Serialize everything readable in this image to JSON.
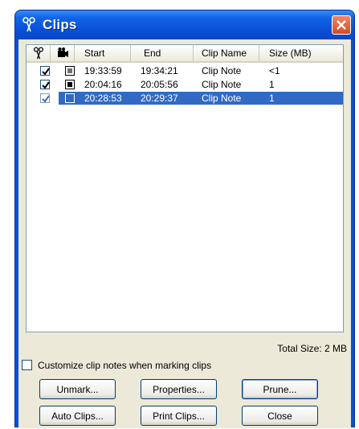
{
  "window": {
    "title": "Clips",
    "accent": "#0a4fd8",
    "icon": "scissors-icon"
  },
  "list": {
    "columns": {
      "mark_icon": "scissors-icon",
      "clip_icon": "camera-icon",
      "start": "Start",
      "end": "End",
      "clip_name": "Clip Name",
      "size": "Size (MB)"
    },
    "rows": [
      {
        "checked": true,
        "clip_state": "grey",
        "start": "19:33:59",
        "end": "19:34:21",
        "name": "Clip Note",
        "size": "<1",
        "selected": false
      },
      {
        "checked": true,
        "clip_state": "black",
        "start": "20:04:16",
        "end": "20:05:56",
        "name": "Clip Note",
        "size": "1",
        "selected": false
      },
      {
        "checked": true,
        "clip_state": "empty",
        "start": "20:28:53",
        "end": "20:29:37",
        "name": "Clip Note",
        "size": "1",
        "selected": true
      }
    ],
    "selection_color": "#316ac5"
  },
  "total_size": "Total Size: 2 MB",
  "customize_option": {
    "label": "Customize clip notes when marking clips",
    "checked": false
  },
  "buttons": {
    "unmark": "Unmark...",
    "properties": "Properties...",
    "prune": "Prune...",
    "auto_clips": "Auto Clips...",
    "print_clips": "Print Clips...",
    "close": "Close"
  }
}
